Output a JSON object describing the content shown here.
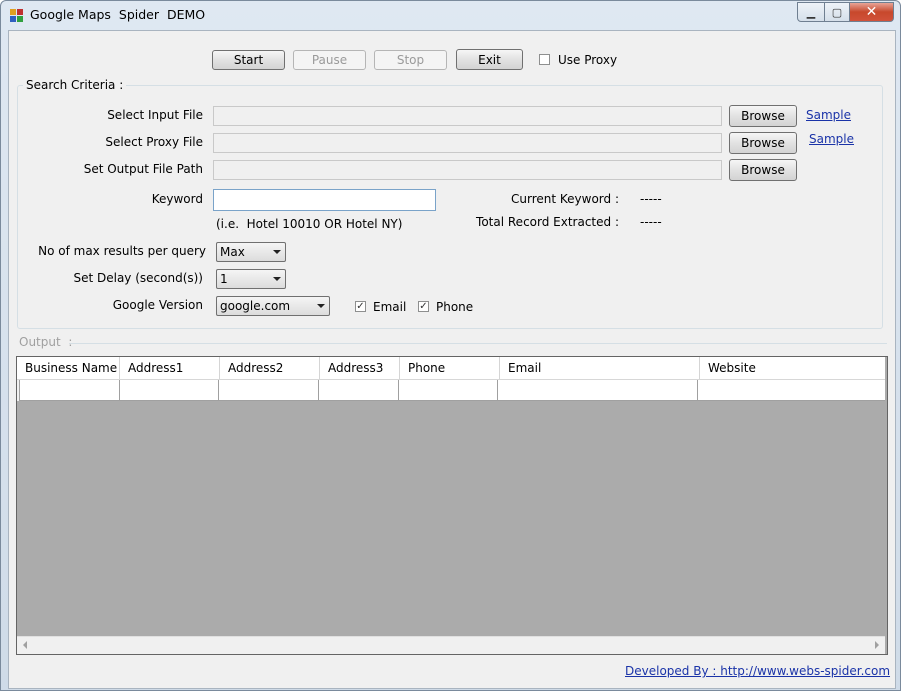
{
  "window": {
    "title": "Google Maps  Spider  DEMO"
  },
  "window_controls": {
    "minimize": "▁",
    "maximize": "▢",
    "close": "✕"
  },
  "toolbar": {
    "start": "Start",
    "pause": "Pause",
    "stop": "Stop",
    "exit": "Exit",
    "use_proxy": "Use Proxy"
  },
  "search": {
    "title": "Search Criteria :",
    "input_file_label": "Select Input File",
    "proxy_file_label": "Select Proxy File",
    "output_path_label": "Set Output File Path",
    "browse": "Browse",
    "sample": "Sample",
    "keyword_label": "Keyword",
    "keyword_value": "",
    "keyword_hint": "(i.e.  Hotel 10010 OR Hotel NY)",
    "current_keyword_label": "Current Keyword :",
    "current_keyword_value": "-----",
    "total_label": "Total Record Extracted :",
    "total_value": "-----",
    "max_results_label": "No of max results per query",
    "max_results_value": "Max",
    "delay_label": "Set Delay (second(s))",
    "delay_value": "1",
    "google_version_label": "Google Version",
    "google_version_value": "google.com",
    "email_label": "Email",
    "phone_label": "Phone"
  },
  "output": {
    "title": "Output  :",
    "columns": [
      "Business Name",
      "Address1",
      "Address2",
      "Address3",
      "Phone",
      "Email",
      "Website"
    ]
  },
  "footer": {
    "developed_by": "Developed By : http://www.webs-spider.com"
  },
  "colors": {
    "link": "#1a33a8",
    "grid_bg": "#ababab",
    "close_button": "#c7482c"
  }
}
